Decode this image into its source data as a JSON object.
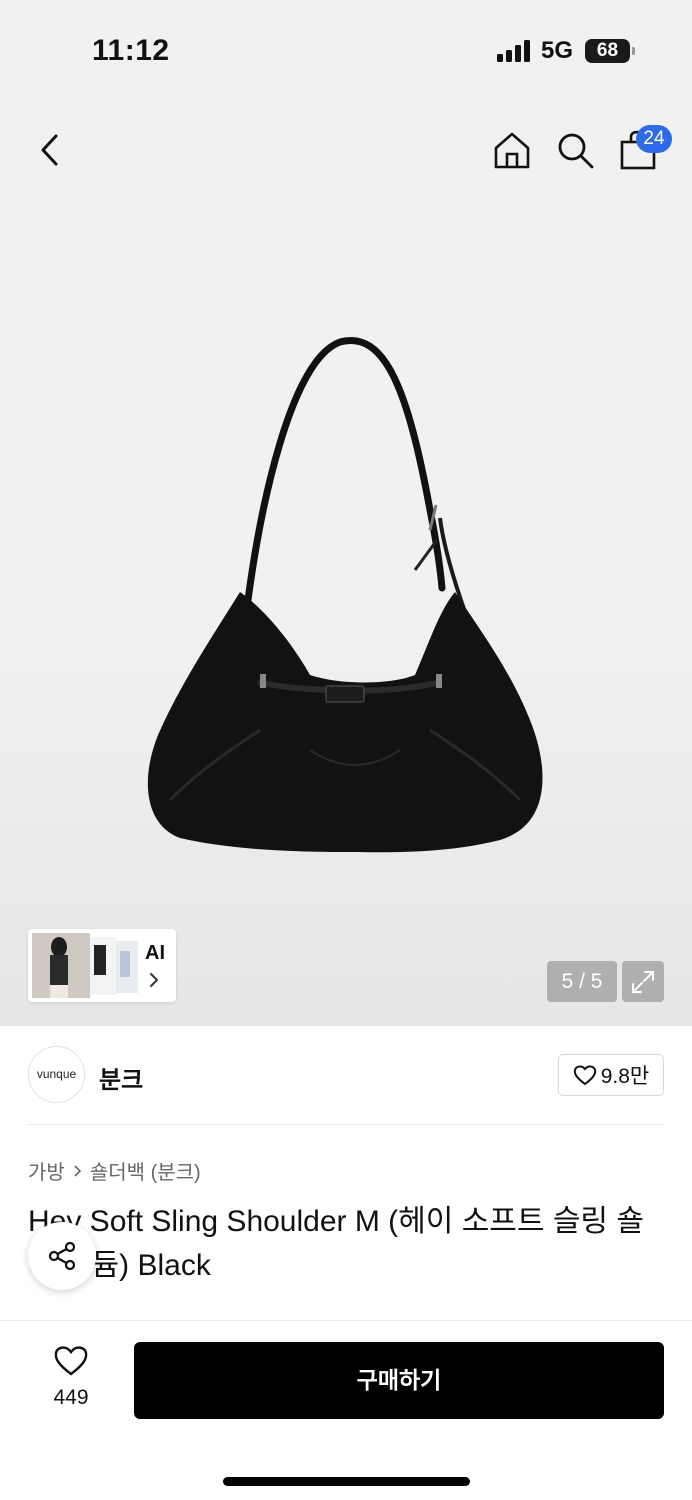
{
  "status_bar": {
    "time": "11:12",
    "network": "5G",
    "battery": "68"
  },
  "nav": {
    "cart_count": "24"
  },
  "gallery": {
    "counter": "5 / 5",
    "ai_label": "AI"
  },
  "brand": {
    "logo_text": "vunque",
    "name": "분크",
    "likes": "9.8만"
  },
  "breadcrumb": {
    "category": "가방",
    "subcategory": "숄더백 (분크)"
  },
  "product": {
    "title": "Hey Soft Sling Shoulder M (헤이 소프트 슬링 숄더 미듐) Black"
  },
  "bottom_bar": {
    "wish_count": "449",
    "buy_label": "구매하기"
  },
  "colors": {
    "accent": "#2f6be8",
    "buy_button": "#000000"
  },
  "icons": [
    "back-icon",
    "home-icon",
    "search-icon",
    "bag-icon",
    "chevron-right-icon",
    "expand-icon",
    "heart-icon",
    "share-icon"
  ]
}
